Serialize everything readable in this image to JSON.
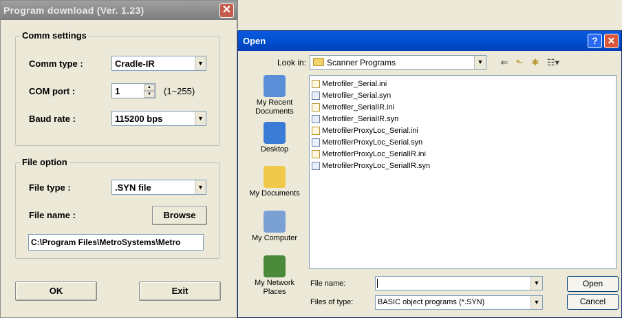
{
  "program_download": {
    "title": "Program download  (Ver. 1.23)",
    "close_glyph": "✕",
    "comm_settings": {
      "legend": "Comm settings",
      "comm_type_label": "Comm type :",
      "comm_type_value": "Cradle-IR",
      "com_port_label": "COM port :",
      "com_port_value": "1",
      "com_port_range": "(1~255)",
      "baud_rate_label": "Baud rate :",
      "baud_rate_value": "115200 bps"
    },
    "file_option": {
      "legend": "File option",
      "file_type_label": "File type :",
      "file_type_value": ".SYN file",
      "file_name_label": "File name :",
      "browse_label": "Browse",
      "path_value": "C:\\Program Files\\MetroSystems\\Metro"
    },
    "ok_label": "OK",
    "exit_label": "Exit"
  },
  "open_dialog": {
    "title": "Open",
    "help_glyph": "?",
    "close_glyph": "✕",
    "look_in_label": "Look in:",
    "look_in_value": "Scanner Programs",
    "places": [
      {
        "label": "My Recent Documents",
        "icon": "recent-documents-icon",
        "color": "#5a8fd8"
      },
      {
        "label": "Desktop",
        "icon": "desktop-icon",
        "color": "#3a7bd5"
      },
      {
        "label": "My Documents",
        "icon": "my-documents-icon",
        "color": "#f0c94a"
      },
      {
        "label": "My Computer",
        "icon": "my-computer-icon",
        "color": "#7aa0d4"
      },
      {
        "label": "My Network Places",
        "icon": "network-places-icon",
        "color": "#4a8a3a"
      }
    ],
    "files": [
      {
        "name": "Metrofiler_Serial.ini",
        "type": "ini"
      },
      {
        "name": "Metrofiler_Serial.syn",
        "type": "syn"
      },
      {
        "name": "Metrofiler_SerialIR.ini",
        "type": "ini"
      },
      {
        "name": "Metrofiler_SerialIR.syn",
        "type": "syn"
      },
      {
        "name": "MetrofilerProxyLoc_Serial.ini",
        "type": "ini"
      },
      {
        "name": "MetrofilerProxyLoc_Serial.syn",
        "type": "syn"
      },
      {
        "name": "MetrofilerProxyLoc_SerialIR.ini",
        "type": "ini"
      },
      {
        "name": "MetrofilerProxyLoc_SerialIR.syn",
        "type": "syn"
      }
    ],
    "file_name_label": "File name:",
    "file_name_value": "",
    "files_of_type_label": "Files of type:",
    "files_of_type_value": "BASIC object programs (*.SYN)",
    "open_label": "Open",
    "cancel_label": "Cancel"
  },
  "colors": {
    "window_bg": "#ece9d8",
    "active_title": "#0054e3",
    "inactive_title": "#8a8a8a"
  }
}
